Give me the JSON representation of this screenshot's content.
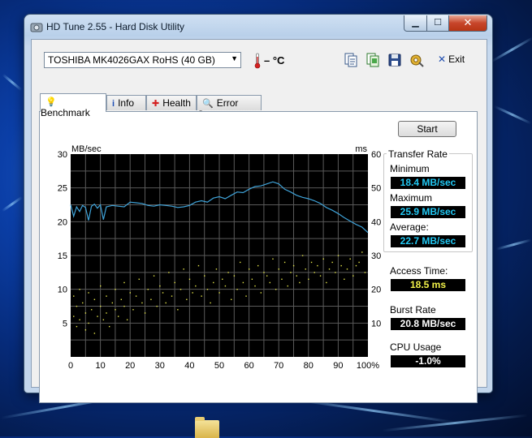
{
  "window": {
    "title": "HD Tune 2.55 - Hard Disk Utility",
    "controls": {
      "minimize": "▁",
      "maximize": "☐",
      "close": "✕"
    }
  },
  "toolbar": {
    "drive": "TOSHIBA MK4026GAX RoHS (40 GB)",
    "temperature": "– °C",
    "exit_label": "Exit",
    "icons": [
      "copy-info-icon",
      "copy-screen-icon",
      "save-icon",
      "options-icon",
      "exit-icon"
    ]
  },
  "tabs": [
    {
      "label": "Benchmark",
      "icon": "lightbulb-icon",
      "active": true
    },
    {
      "label": "Info",
      "icon": "info-icon",
      "active": false
    },
    {
      "label": "Health",
      "icon": "health-cross-icon",
      "active": false
    },
    {
      "label": "Error Scan",
      "icon": "magnifier-icon",
      "active": false
    }
  ],
  "chart_data": {
    "type": "line",
    "left_axis_label": "MB/sec",
    "right_axis_label": "ms",
    "ylim": [
      0,
      30
    ],
    "y_ticks": [
      5,
      10,
      15,
      20,
      25,
      30
    ],
    "y2lim": [
      0,
      60
    ],
    "y2_ticks": [
      10,
      20,
      30,
      40,
      50,
      60
    ],
    "xlim": [
      0,
      100
    ],
    "x_tick_labels": [
      "0",
      "10",
      "20",
      "30",
      "40",
      "50",
      "60",
      "70",
      "80",
      "90",
      "100%"
    ],
    "grid": true,
    "background": "#000000",
    "series": [
      {
        "type": "line",
        "color": "#3fa3d9",
        "x": [
          0,
          1,
          2,
          3,
          4,
          5,
          6,
          7,
          8,
          9,
          10,
          11,
          12,
          14,
          16,
          18,
          20,
          22,
          24,
          26,
          28,
          30,
          32,
          34,
          36,
          38,
          40,
          42,
          44,
          46,
          48,
          50,
          52,
          54,
          56,
          58,
          60,
          62,
          64,
          66,
          68,
          70,
          72,
          74,
          76,
          78,
          80,
          82,
          84,
          86,
          88,
          90,
          92,
          94,
          96,
          98,
          100
        ],
        "y": [
          22.5,
          20.8,
          22.2,
          21.5,
          22.4,
          22.1,
          20.2,
          22.3,
          22.6,
          22.0,
          22.5,
          20.3,
          22.2,
          22.4,
          22.3,
          22.2,
          22.9,
          22.8,
          22.7,
          22.4,
          22.3,
          22.5,
          22.4,
          22.3,
          22.1,
          22.2,
          22.4,
          22.9,
          23.1,
          22.9,
          23.5,
          23.7,
          23.4,
          23.9,
          24.4,
          24.3,
          24.8,
          25.2,
          25.3,
          25.6,
          25.9,
          25.6,
          24.8,
          24.4,
          23.9,
          23.6,
          23.4,
          23.1,
          22.7,
          22.1,
          21.7,
          21.2,
          20.6,
          20.1,
          19.6,
          19.2,
          18.4
        ]
      },
      {
        "type": "scatter",
        "axis": "right",
        "color": "#e6e64a",
        "x": [
          1,
          1,
          2,
          2,
          3,
          3,
          4,
          5,
          5,
          6,
          6,
          7,
          8,
          8,
          9,
          10,
          10,
          11,
          12,
          12,
          13,
          14,
          15,
          15,
          16,
          17,
          18,
          18,
          19,
          20,
          21,
          22,
          23,
          24,
          25,
          26,
          27,
          28,
          29,
          30,
          31,
          32,
          33,
          34,
          35,
          36,
          37,
          38,
          39,
          40,
          41,
          42,
          43,
          44,
          45,
          46,
          47,
          48,
          49,
          50,
          51,
          52,
          53,
          54,
          55,
          56,
          57,
          58,
          59,
          60,
          61,
          62,
          63,
          64,
          65,
          66,
          67,
          68,
          69,
          70,
          71,
          72,
          73,
          74,
          75,
          76,
          77,
          78,
          79,
          80,
          81,
          82,
          83,
          84,
          85,
          86,
          87,
          88,
          89,
          90,
          91,
          92,
          93,
          94,
          95,
          96,
          97,
          98,
          99
        ],
        "y": [
          12,
          18,
          9,
          15,
          20,
          11,
          16,
          8,
          13,
          19,
          10,
          14,
          17,
          7,
          12,
          21,
          15,
          11,
          18,
          13,
          9,
          16,
          20,
          14,
          12,
          17,
          22,
          15,
          11,
          19,
          14,
          18,
          23,
          16,
          13,
          20,
          17,
          24,
          15,
          21,
          19,
          16,
          25,
          18,
          22,
          14,
          20,
          26,
          17,
          23,
          19,
          21,
          27,
          18,
          24,
          20,
          16,
          22,
          26,
          19,
          23,
          21,
          25,
          17,
          24,
          20,
          28,
          22,
          18,
          26,
          23,
          21,
          27,
          19,
          25,
          24,
          22,
          29,
          20,
          26,
          23,
          28,
          21,
          25,
          27,
          24,
          22,
          30,
          26,
          23,
          28,
          25,
          27,
          24,
          29,
          22,
          26,
          28,
          25,
          30,
          27,
          23,
          26,
          29,
          24,
          27,
          28,
          31,
          25
        ],
        "note_unit": "ms"
      }
    ]
  },
  "results": {
    "start_label": "Start",
    "transfer_rate_title": "Transfer Rate",
    "minimum_label": "Minimum",
    "minimum_value": "18.4 MB/sec",
    "maximum_label": "Maximum",
    "maximum_value": "25.9 MB/sec",
    "average_label": "Average:",
    "average_value": "22.7 MB/sec",
    "access_label": "Access Time:",
    "access_value": "18.5 ms",
    "burst_label": "Burst Rate",
    "burst_value": "20.8 MB/sec",
    "cpu_label": "CPU Usage",
    "cpu_value": "-1.0%"
  }
}
